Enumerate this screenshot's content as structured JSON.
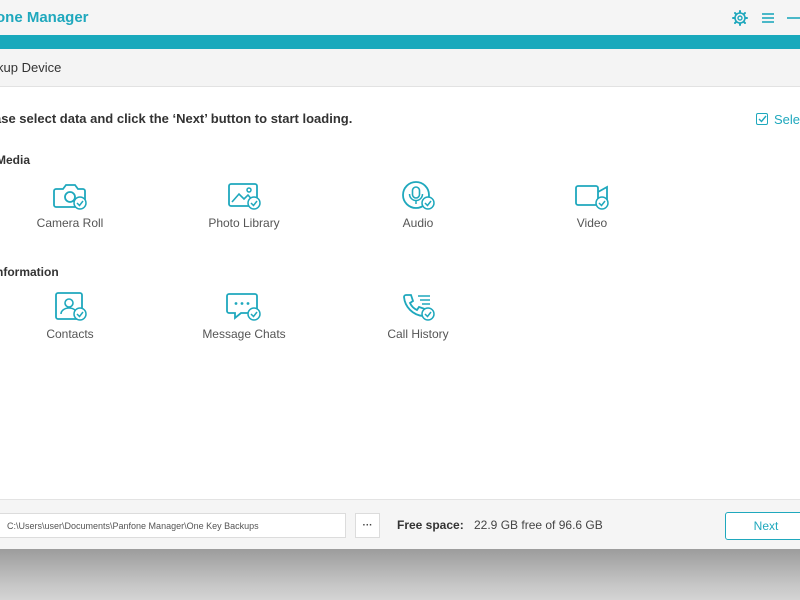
{
  "window": {
    "title": "one Manager",
    "controls": [
      {
        "name": "gear-icon"
      },
      {
        "name": "menu-icon"
      },
      {
        "name": "minimize-icon"
      }
    ]
  },
  "subheader": {
    "title": "kup Device"
  },
  "main": {
    "instruction": "ase select data and click the ‘Next’ button to start loading.",
    "select_all_label": "Selec",
    "sections": [
      {
        "label": "Media",
        "items": [
          {
            "label": "Camera Roll",
            "icon": "camera-icon"
          },
          {
            "label": "Photo Library",
            "icon": "photo-icon"
          },
          {
            "label": "Audio",
            "icon": "microphone-icon"
          },
          {
            "label": "Video",
            "icon": "video-camera-icon"
          }
        ]
      },
      {
        "label": "nformation",
        "items": [
          {
            "label": "Contacts",
            "icon": "contact-card-icon"
          },
          {
            "label": "Message Chats",
            "icon": "message-bubble-icon"
          },
          {
            "label": "Call History",
            "icon": "phone-icon"
          }
        ]
      }
    ]
  },
  "footer": {
    "backup_path": "C:\\Users\\user\\Documents\\Panfone Manager\\One Key Backups",
    "browse_label": "···",
    "free_space_label": "Free space:",
    "free_space_value": "22.9 GB free of 96.6 GB",
    "next_label": "Next"
  },
  "colors": {
    "accent": "#1fa8bd",
    "band": "#19a9bc",
    "background": "#ffffff"
  }
}
